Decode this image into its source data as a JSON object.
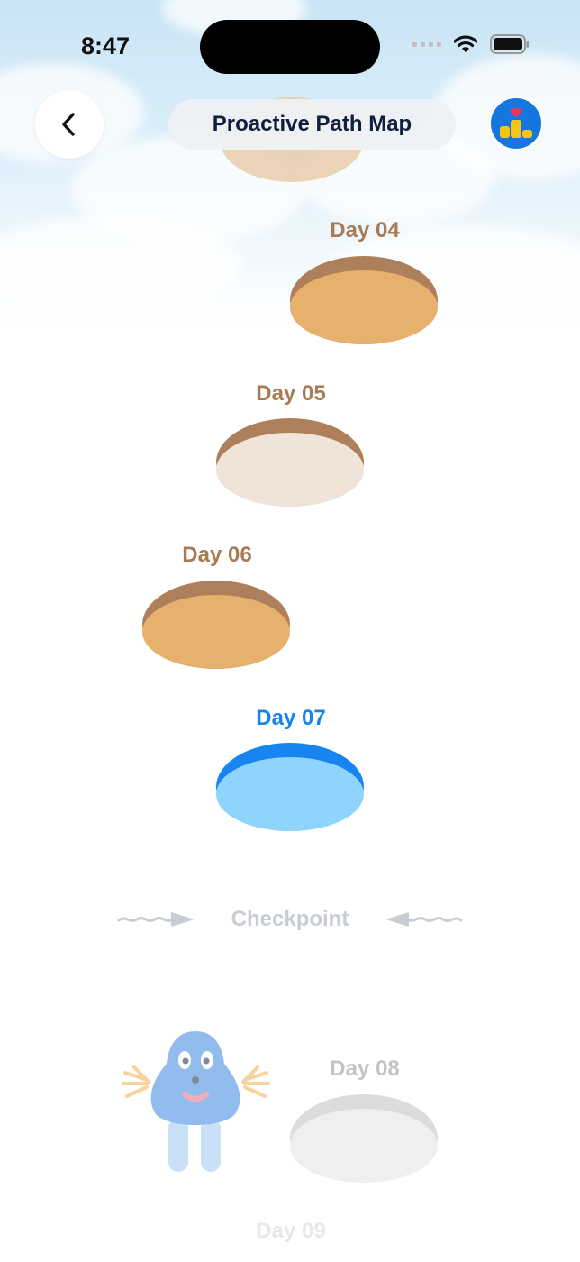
{
  "status_bar": {
    "time": "8:47"
  },
  "header": {
    "title": "Proactive Path Map"
  },
  "path": {
    "days": [
      {
        "label": "Day 04",
        "state": "completed"
      },
      {
        "label": "Day 05",
        "state": "partial"
      },
      {
        "label": "Day 06",
        "state": "completed"
      },
      {
        "label": "Day 07",
        "state": "current"
      },
      {
        "label": "Day 08",
        "state": "locked"
      },
      {
        "label": "Day 09",
        "state": "locked"
      }
    ],
    "checkpoint_label": "Checkpoint"
  },
  "colors": {
    "completed_top": "#e6b06d",
    "completed_rim": "#ad805b",
    "partial_top": "#f0e3d7",
    "current_top": "#8ed4fd",
    "current_rim": "#1784ef",
    "current_label": "#1684ec",
    "completed_label": "#a97b55",
    "locked_label": "#c4c4c4",
    "rank_badge": "#1676e0"
  },
  "icons": {
    "back": "chevron-left-icon",
    "rank": "podium-heart-icon",
    "signal": "signal-icon",
    "wifi": "wifi-icon",
    "battery": "battery-icon"
  }
}
